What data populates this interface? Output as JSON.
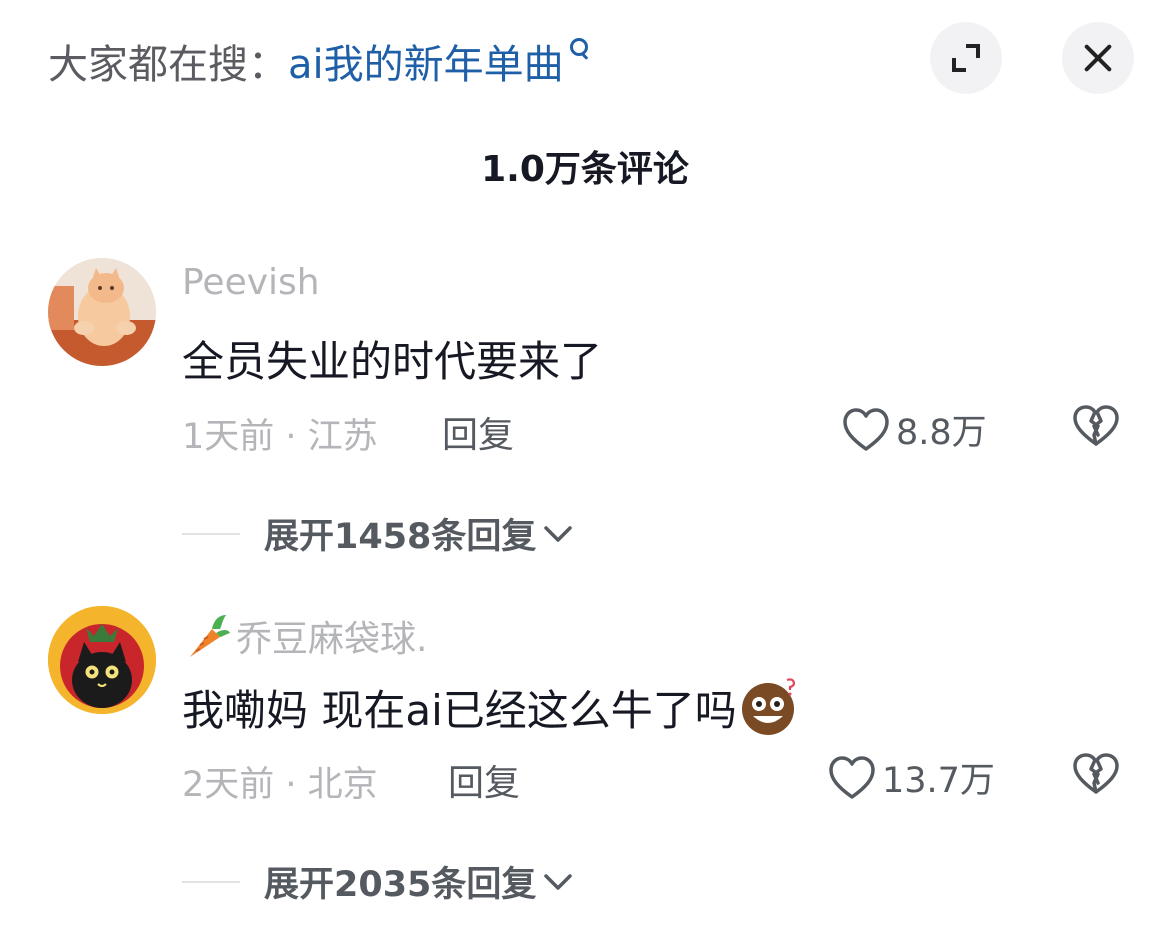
{
  "search": {
    "prefix": "大家都在搜：",
    "query": "ai我的新年单曲"
  },
  "header": {
    "comment_count": "1.0万条评论"
  },
  "comments": [
    {
      "username": "Peevish",
      "text": "全员失业的时代要来了",
      "time_location": "1天前 · 江苏",
      "reply_label": "回复",
      "likes": "8.8万",
      "expand_replies": "展开1458条回复"
    },
    {
      "username": "乔豆麻袋球.",
      "username_icon": "carrot-icon",
      "text": "我嘞妈 现在ai已经这么牛了吗",
      "text_emoji": "confused-face-emoji",
      "time_location": "2天前 · 北京",
      "reply_label": "回复",
      "likes": "13.7万",
      "expand_replies": "展开2035条回复"
    }
  ],
  "colors": {
    "search_link": "#1f5fa8",
    "muted_text": "#b4b5b9",
    "secondary_text": "#555a61",
    "primary_text": "#161823",
    "button_bg": "#f2f2f4"
  }
}
